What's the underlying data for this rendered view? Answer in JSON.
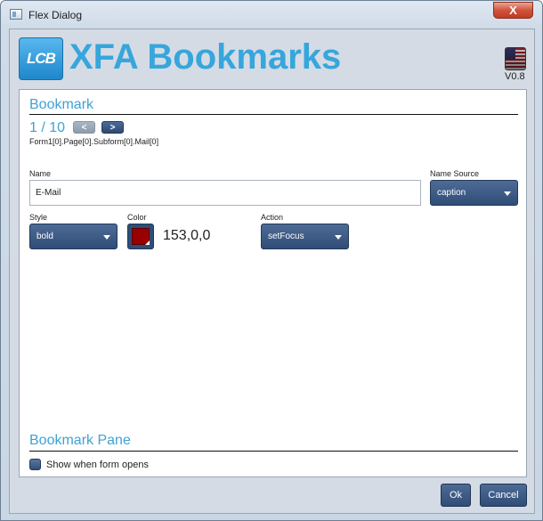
{
  "window": {
    "title": "Flex Dialog",
    "close_label": "X"
  },
  "header": {
    "logo_text": "LCB",
    "app_title": "XFA Bookmarks",
    "version": "V0.8"
  },
  "bookmark": {
    "section_title": "Bookmark",
    "pager": {
      "text": "1 / 10",
      "prev_label": "<",
      "next_label": ">"
    },
    "som_path": "Form1[0].Page[0].Subform[0].Mail[0]",
    "name": {
      "label": "Name",
      "value": "E-Mail"
    },
    "name_source": {
      "label": "Name Source",
      "selected": "caption"
    },
    "style": {
      "label": "Style",
      "selected": "bold"
    },
    "color": {
      "label": "Color",
      "value": "153,0,0",
      "swatch_hex": "#990000"
    },
    "action": {
      "label": "Action",
      "selected": "setFocus"
    }
  },
  "pane": {
    "section_title": "Bookmark Pane",
    "show_checkbox_label": "Show when form opens",
    "show_checked": false
  },
  "buttons": {
    "ok": "Ok",
    "cancel": "Cancel"
  },
  "colors": {
    "accent": "#3ea2d6",
    "button": "#2f4d76",
    "close": "#c13b22"
  }
}
